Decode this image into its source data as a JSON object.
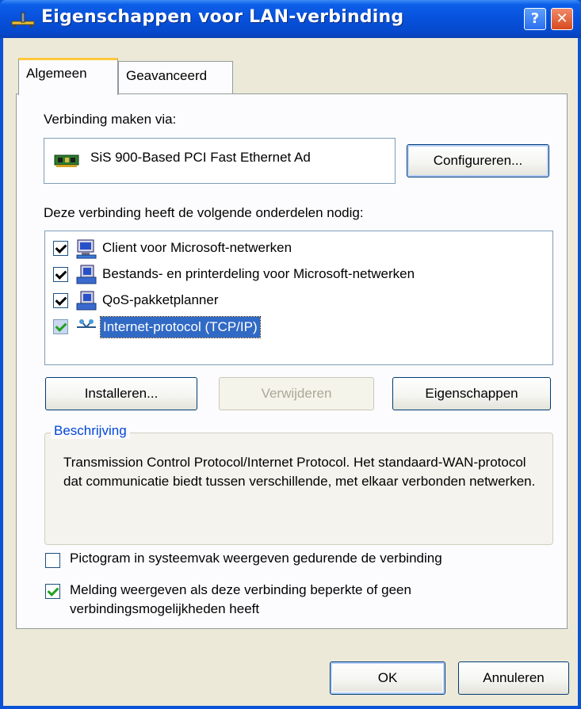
{
  "window": {
    "title": "Eigenschappen voor LAN-verbinding",
    "help_glyph": "?",
    "close_glyph": "✕"
  },
  "tabs": [
    {
      "label": "Algemeen",
      "active": true
    },
    {
      "label": "Geavanceerd",
      "active": false
    }
  ],
  "connect_via": {
    "label": "Verbinding maken via:",
    "adapter_name": "SiS 900-Based PCI Fast Ethernet Ad",
    "configure_button": "Configureren..."
  },
  "components": {
    "label": "Deze verbinding heeft de volgende onderdelen nodig:",
    "items": [
      {
        "label": "Client voor Microsoft-netwerken",
        "checked": true,
        "icon": "network-client-icon"
      },
      {
        "label": "Bestands- en printerdeling voor Microsoft-netwerken",
        "checked": true,
        "icon": "network-service-icon"
      },
      {
        "label": "QoS-pakketplanner",
        "checked": true,
        "icon": "network-service-icon"
      },
      {
        "label": "Internet-protocol (TCP/IP)",
        "checked": true,
        "selected": true,
        "icon": "network-protocol-icon"
      }
    ]
  },
  "actions": {
    "install": "Installeren...",
    "remove": "Verwijderen",
    "properties": "Eigenschappen"
  },
  "description": {
    "title": "Beschrijving",
    "text": "Transmission Control Protocol/Internet Protocol. Het standaard-WAN-protocol dat communicatie biedt tussen verschillende, met elkaar verbonden netwerken."
  },
  "options": [
    {
      "label": "Pictogram in systeemvak weergeven gedurende de verbinding",
      "checked": false
    },
    {
      "label": "Melding weergeven als deze verbinding beperkte of geen verbindingsmogelijkheden heeft",
      "checked": true
    }
  ],
  "footer": {
    "ok": "OK",
    "cancel": "Annuleren"
  },
  "colors": {
    "titlebar": "#0751dc",
    "dialog_bg": "#ece9d8",
    "selection": "#316ac5",
    "group_title": "#0046d5"
  }
}
